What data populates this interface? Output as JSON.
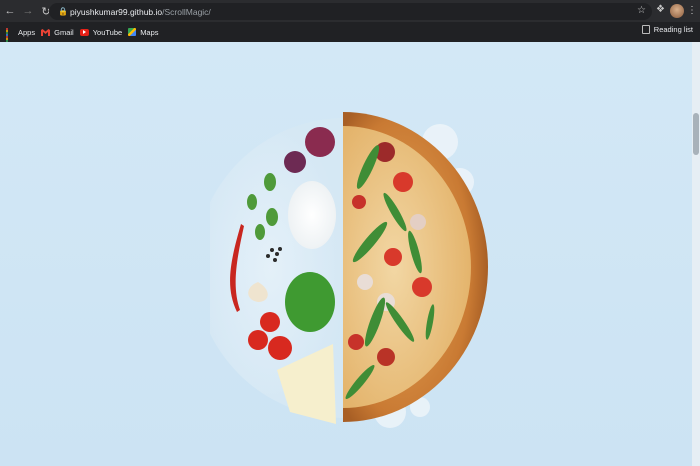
{
  "browser": {
    "url_host": "piyushkumar99.github.io",
    "url_path": "/ScrollMagic/",
    "bookmarks": [
      {
        "label": "Apps",
        "icon": "apps-grid-icon"
      },
      {
        "label": "Gmail",
        "icon": "gmail-icon"
      },
      {
        "label": "YouTube",
        "icon": "youtube-icon"
      },
      {
        "label": "Maps",
        "icon": "maps-icon"
      }
    ],
    "reading_list_label": "Reading list"
  },
  "page": {
    "background_color": "#d0e6f4",
    "image": "half-pizza-with-ingredients-illustration"
  }
}
